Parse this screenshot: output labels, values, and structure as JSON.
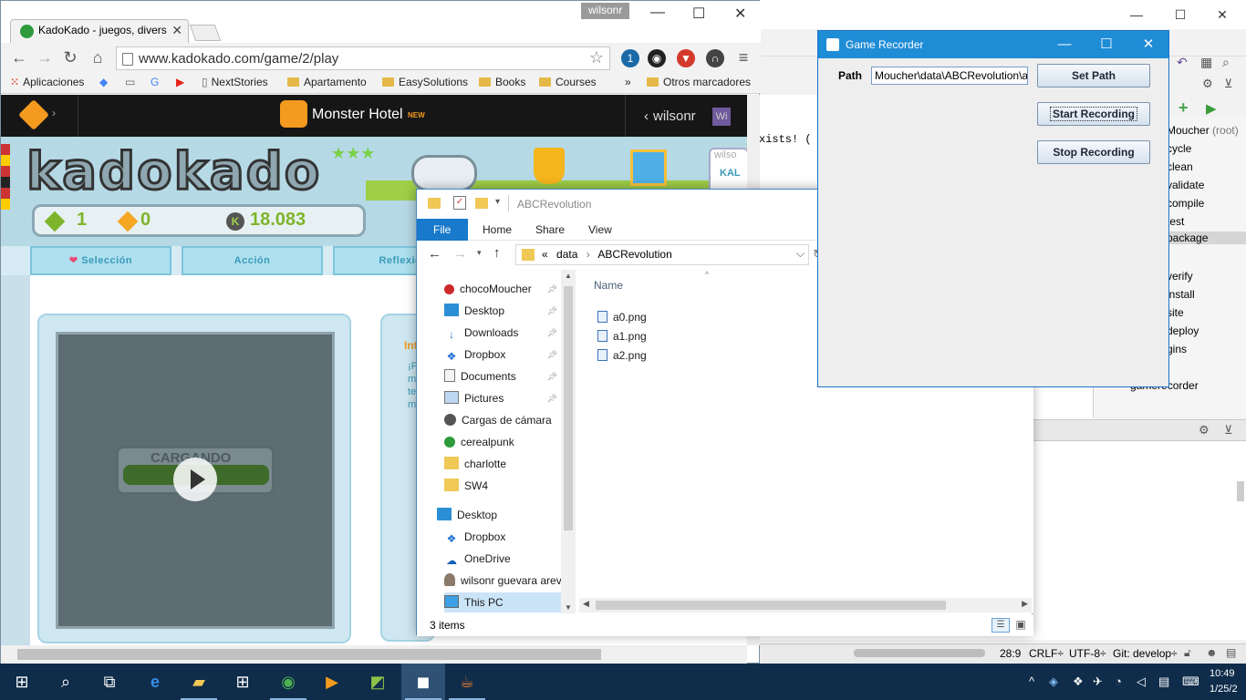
{
  "chrome": {
    "tab_title": "KadoKado - juegos, divers",
    "profile_name": "wilsonr",
    "url": "www.kadokado.com/game/2/play",
    "bookmarks": [
      "Aplicaciones",
      "NextStories",
      "Apartamento",
      "EasySolutions",
      "Books",
      "Courses"
    ],
    "bookmarks_more": "»",
    "bookmarks_other": "Otros marcadores",
    "site": {
      "game_title": "Monster Hotel",
      "new_badge": "NEW",
      "user": "wilsonr",
      "user_prefix": "‹",
      "user_initials": "Wi",
      "logo": "kadokado",
      "stat_green": "1",
      "stat_orange": "0",
      "stat_kubors": "18.083",
      "categories": [
        "Selección",
        "Acción",
        "Reflexión"
      ],
      "loading_text": "CARGANDO",
      "side_title": "Int",
      "side_lines": [
        "¡P",
        "m",
        "te",
        "m"
      ],
      "right_box": "wilso",
      "right_box2": "KAL"
    }
  },
  "explorer": {
    "title": "ABCRevolution",
    "tabs": [
      "File",
      "Home",
      "Share",
      "View"
    ],
    "breadcrumb": [
      "«",
      "data",
      "ABCRevolution"
    ],
    "nav_items": [
      {
        "label": "chocoMoucher",
        "pinned": true,
        "icon": "user-folder-icon"
      },
      {
        "label": "Desktop",
        "pinned": true,
        "icon": "desktop-icon"
      },
      {
        "label": "Downloads",
        "pinned": true,
        "icon": "download-icon"
      },
      {
        "label": "Dropbox",
        "pinned": true,
        "icon": "dropbox-icon"
      },
      {
        "label": "Documents",
        "pinned": true,
        "icon": "documents-icon"
      },
      {
        "label": "Pictures",
        "pinned": true,
        "icon": "pictures-icon"
      },
      {
        "label": "Cargas de cámara",
        "pinned": false,
        "icon": "camera-icon"
      },
      {
        "label": "cerealpunk",
        "pinned": false,
        "icon": "folder-icon"
      },
      {
        "label": "charlotte",
        "pinned": false,
        "icon": "folder-icon"
      },
      {
        "label": "SW4",
        "pinned": false,
        "icon": "folder-icon"
      }
    ],
    "nav_root": [
      {
        "label": "Desktop",
        "icon": "desktop-icon"
      },
      {
        "label": "Dropbox",
        "icon": "dropbox-icon"
      },
      {
        "label": "OneDrive",
        "icon": "onedrive-icon"
      },
      {
        "label": "wilsonr guevara arev",
        "icon": "user-icon"
      },
      {
        "label": "This PC",
        "icon": "pc-icon"
      }
    ],
    "column_name": "Name",
    "files": [
      "a0.png",
      "a1.png",
      "a2.png"
    ],
    "status": "3 items"
  },
  "recorder": {
    "title": "Game Recorder",
    "path_label": "Path",
    "path_value": "Moucher\\data\\ABCRevolution\\a",
    "set_path": "Set Path",
    "start": "Start Recording",
    "stop": "Stop Recording"
  },
  "ide": {
    "code_fragment": "xists! (",
    "maven_root": "Moucher",
    "maven_root_suffix": "(root)",
    "maven_items": [
      "cycle",
      "clean",
      "validate",
      "compile",
      "test",
      "package",
      "verify",
      "install",
      "site",
      "deploy",
      "gins",
      "ns"
    ],
    "maven_selected": "package",
    "module": "gamerecorder",
    "status": {
      "position": "28:9",
      "line_sep": "CRLF÷",
      "encoding": "UTF-8÷",
      "git": "Git: develop÷"
    }
  },
  "taskbar": {
    "time": "10:49",
    "date": "1/25/2"
  },
  "colors": {
    "taskbar": "#0f2c4a",
    "recorder_title": "#1f8cd6",
    "explorer_file_tab": "#1979ca"
  }
}
